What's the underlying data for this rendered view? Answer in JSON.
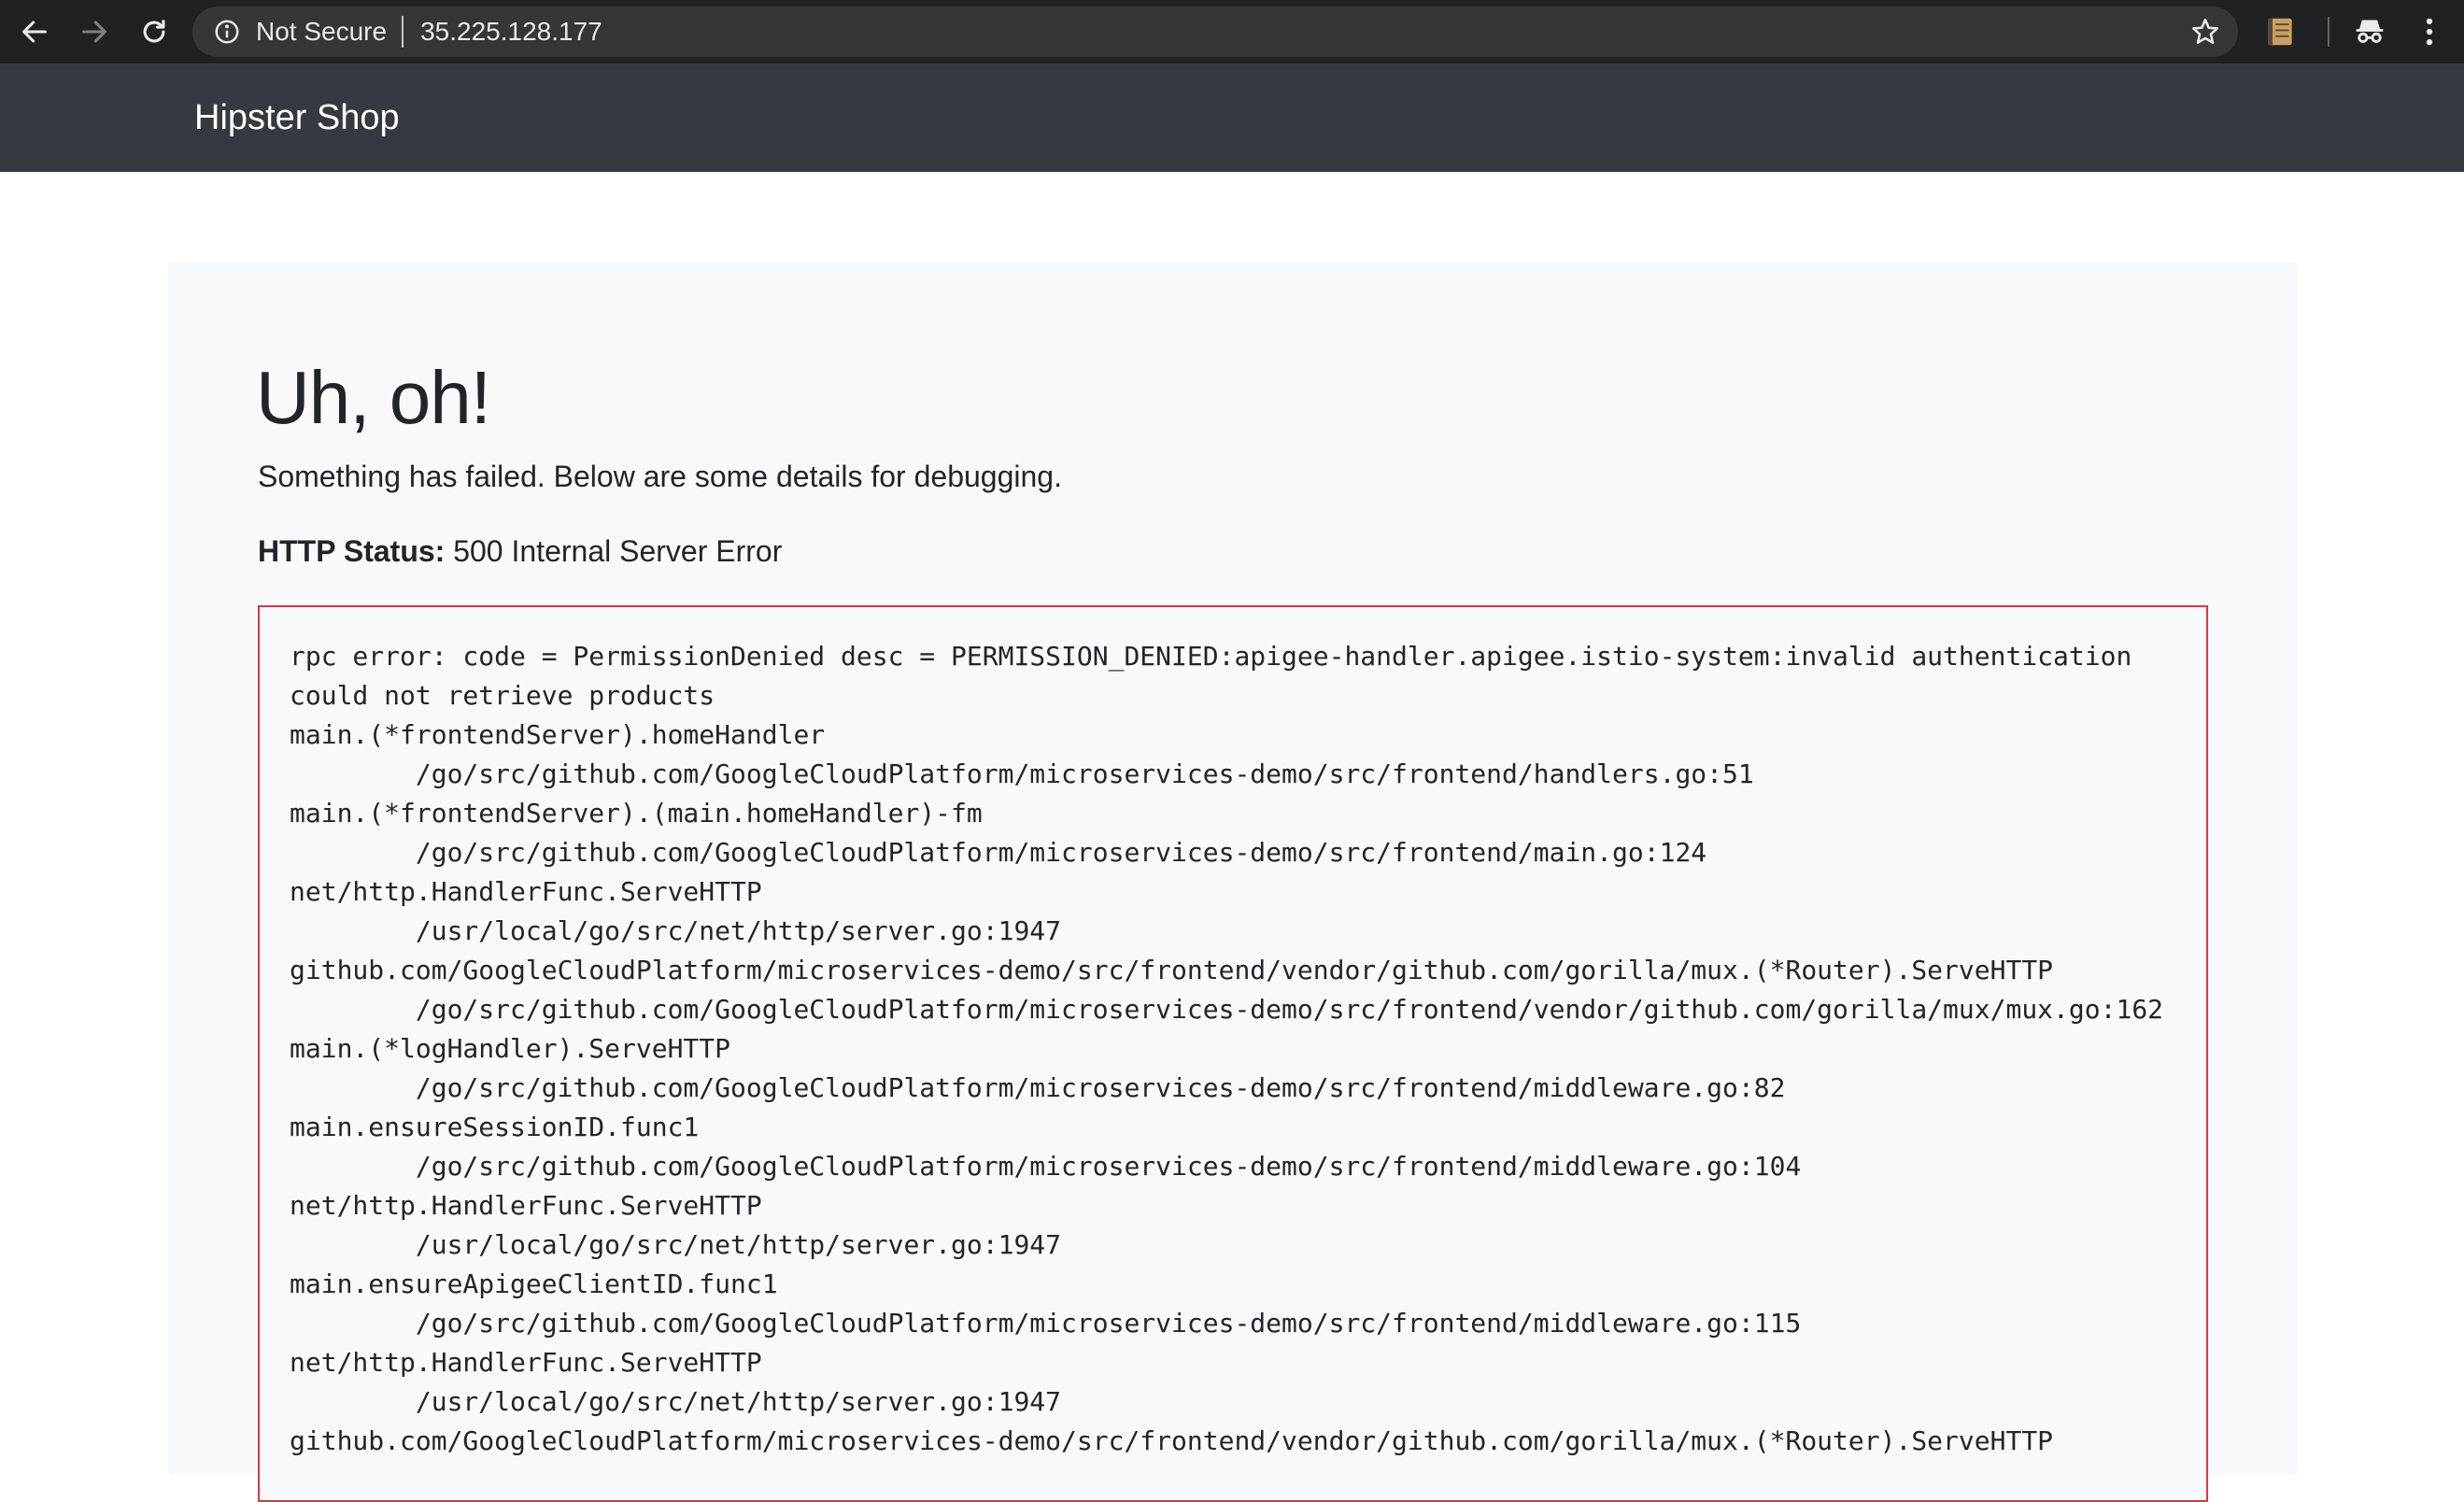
{
  "browser": {
    "security_label": "Not Secure",
    "url": "35.225.128.177",
    "icons": {
      "back": "back-arrow-icon",
      "forward": "forward-arrow-icon",
      "reload": "reload-icon",
      "info": "info-icon",
      "star": "star-icon",
      "extension": "notes-extension-icon",
      "incognito": "incognito-icon",
      "menu": "kebab-menu-icon"
    }
  },
  "header": {
    "brand": "Hipster Shop"
  },
  "error": {
    "title": "Uh, oh!",
    "subtitle": "Something has failed. Below are some details for debugging.",
    "status_label": "HTTP Status:",
    "status_value": " 500 Internal Server Error",
    "trace_lines": [
      "rpc error: code = PermissionDenied desc = PERMISSION_DENIED:apigee-handler.apigee.istio-system:invalid authentication",
      "could not retrieve products",
      "main.(*frontendServer).homeHandler",
      "\t/go/src/github.com/GoogleCloudPlatform/microservices-demo/src/frontend/handlers.go:51",
      "main.(*frontendServer).(main.homeHandler)-fm",
      "\t/go/src/github.com/GoogleCloudPlatform/microservices-demo/src/frontend/main.go:124",
      "net/http.HandlerFunc.ServeHTTP",
      "\t/usr/local/go/src/net/http/server.go:1947",
      "github.com/GoogleCloudPlatform/microservices-demo/src/frontend/vendor/github.com/gorilla/mux.(*Router).ServeHTTP",
      "\t/go/src/github.com/GoogleCloudPlatform/microservices-demo/src/frontend/vendor/github.com/gorilla/mux/mux.go:162",
      "main.(*logHandler).ServeHTTP",
      "\t/go/src/github.com/GoogleCloudPlatform/microservices-demo/src/frontend/middleware.go:82",
      "main.ensureSessionID.func1",
      "\t/go/src/github.com/GoogleCloudPlatform/microservices-demo/src/frontend/middleware.go:104",
      "net/http.HandlerFunc.ServeHTTP",
      "\t/usr/local/go/src/net/http/server.go:1947",
      "main.ensureApigeeClientID.func1",
      "\t/go/src/github.com/GoogleCloudPlatform/microservices-demo/src/frontend/middleware.go:115",
      "net/http.HandlerFunc.ServeHTTP",
      "\t/usr/local/go/src/net/http/server.go:1947",
      "github.com/GoogleCloudPlatform/microservices-demo/src/frontend/vendor/github.com/gorilla/mux.(*Router).ServeHTTP"
    ]
  },
  "colors": {
    "chrome_bg": "#202124",
    "omnibox_bg": "#35363a",
    "header_bg": "#343a40",
    "panel_bg": "#f8f9fa",
    "trace_border": "#dc3545",
    "text": "#212529"
  }
}
